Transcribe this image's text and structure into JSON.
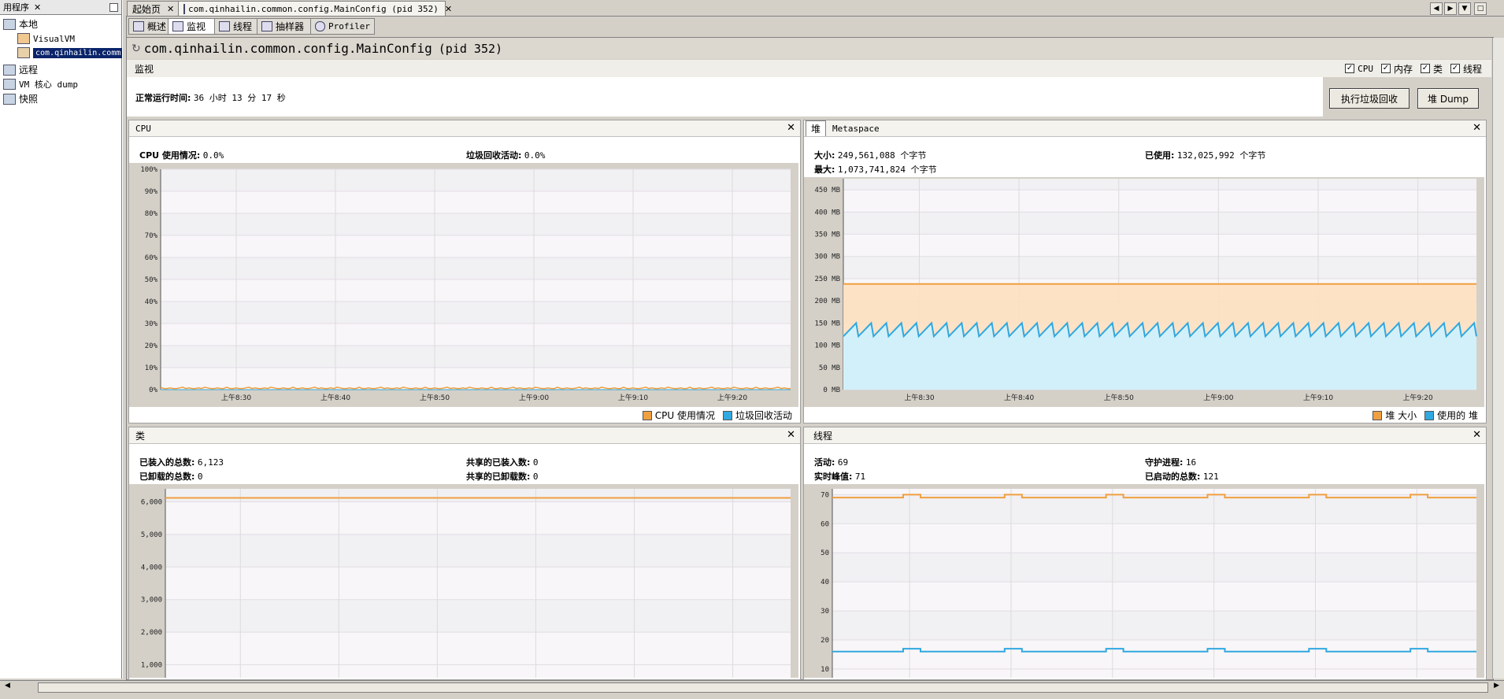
{
  "left_panel": {
    "tab_label": "用程序",
    "tree": {
      "local": "本地",
      "visualvm": "VisualVM",
      "selected_app": "com.qinhailin.comm",
      "remote": "远程",
      "vm_core_dump": "VM 核心 dump",
      "snapshots": "快照"
    }
  },
  "tabs": {
    "start_page": "起始页",
    "app_tab": "com.qinhailin.common.config.MainConfig (pid 352)"
  },
  "subtabs": [
    "概述",
    "监视",
    "线程",
    "抽样器",
    "Profiler"
  ],
  "header": {
    "process_title": "com.qinhailin.common.config.MainConfig",
    "pid": "(pid 352)",
    "section": "监视",
    "checkboxes": [
      "CPU",
      "内存",
      "类",
      "线程"
    ],
    "uptime_label": "正常运行时间:",
    "uptime_value": "36 小时 13 分 17 秒",
    "gc_button": "执行垃圾回收",
    "heap_dump_button": "堆 Dump"
  },
  "time_labels": [
    "上午8:30",
    "上午8:40",
    "上午8:50",
    "上午9:00",
    "上午9:10",
    "上午9:20"
  ],
  "cpu_panel": {
    "title": "CPU",
    "usage_label": "CPU 使用情况:",
    "usage_value": "0.0%",
    "gc_label": "垃圾回收活动:",
    "gc_value": "0.0%",
    "legend": [
      "CPU 使用情况",
      "垃圾回收活动"
    ]
  },
  "heap_panel": {
    "tab_heap": "堆",
    "tab_metaspace": "Metaspace",
    "size_label": "大小:",
    "size_value": "249,561,088 个字节",
    "max_label": "最大:",
    "max_value": "1,073,741,824 个字节",
    "used_label": "已使用:",
    "used_value": "132,025,992 个字节",
    "legend": [
      "堆 大小",
      "使用的 堆"
    ]
  },
  "classes_panel": {
    "title": "类",
    "loaded_label": "已装入的总数:",
    "loaded_value": "6,123",
    "unloaded_label": "已卸载的总数:",
    "unloaded_value": "0",
    "shared_loaded_label": "共享的已装入数:",
    "shared_loaded_value": "0",
    "shared_unloaded_label": "共享的已卸载数:",
    "shared_unloaded_value": "0"
  },
  "threads_panel": {
    "title": "线程",
    "live_label": "活动:",
    "live_value": "69",
    "peak_label": "实时峰值:",
    "peak_value": "71",
    "daemon_label": "守护进程:",
    "daemon_value": "16",
    "started_label": "已启动的总数:",
    "started_value": "121"
  },
  "colors": {
    "orange": "#f0a040",
    "blue": "#30a8e0",
    "orange_fill": "#fde0c0",
    "blue_fill": "#d0f0fc"
  },
  "chart_data": [
    {
      "type": "line",
      "name": "cpu",
      "x": [
        "上午8:30",
        "上午8:40",
        "上午8:50",
        "上午9:00",
        "上午9:10",
        "上午9:20"
      ],
      "series": [
        {
          "name": "CPU 使用情况",
          "values": [
            0.5,
            0.5,
            0.5,
            0.5,
            0.5,
            0.5
          ]
        },
        {
          "name": "垃圾回收活动",
          "values": [
            0,
            0,
            0,
            0,
            0,
            0
          ]
        }
      ],
      "yticks": [
        "0%",
        "10%",
        "20%",
        "30%",
        "40%",
        "50%",
        "60%",
        "70%",
        "80%",
        "90%",
        "100%"
      ],
      "ylim": [
        0,
        100
      ]
    },
    {
      "type": "area",
      "name": "heap",
      "x": [
        "上午8:30",
        "上午8:40",
        "上午8:50",
        "上午9:00",
        "上午9:10",
        "上午9:20"
      ],
      "series": [
        {
          "name": "堆 大小",
          "values": [
            238,
            238,
            238,
            238,
            238,
            238
          ]
        },
        {
          "name": "使用的 堆",
          "range": [
            120,
            150
          ],
          "pattern": "sawtooth",
          "cycles": 42
        }
      ],
      "yticks": [
        "0 MB",
        "50 MB",
        "100 MB",
        "150 MB",
        "200 MB",
        "250 MB",
        "300 MB",
        "350 MB",
        "400 MB",
        "450 MB"
      ],
      "ylim": [
        0,
        475
      ]
    },
    {
      "type": "line",
      "name": "classes",
      "x": [
        "上午8:30",
        "上午8:40",
        "上午8:50",
        "上午9:00",
        "上午9:10",
        "上午9:20"
      ],
      "series": [
        {
          "name": "已装入的总数",
          "values": [
            6123,
            6123,
            6123,
            6123,
            6123,
            6123
          ]
        }
      ],
      "yticks": [
        "1,000",
        "2,000",
        "3,000",
        "4,000",
        "5,000",
        "6,000"
      ],
      "ylim": [
        600,
        6400
      ]
    },
    {
      "type": "line",
      "name": "threads",
      "x": [
        "上午8:30",
        "上午8:40",
        "上午8:50",
        "上午9:00",
        "上午9:10",
        "上午9:20"
      ],
      "series": [
        {
          "name": "活动",
          "base": 69,
          "peak": 70,
          "pulses": 6
        },
        {
          "name": "守护进程",
          "base": 16,
          "peak": 17,
          "pulses": 6
        }
      ],
      "yticks": [
        "10",
        "20",
        "30",
        "40",
        "50",
        "60",
        "70"
      ],
      "ylim": [
        7,
        72
      ]
    }
  ]
}
